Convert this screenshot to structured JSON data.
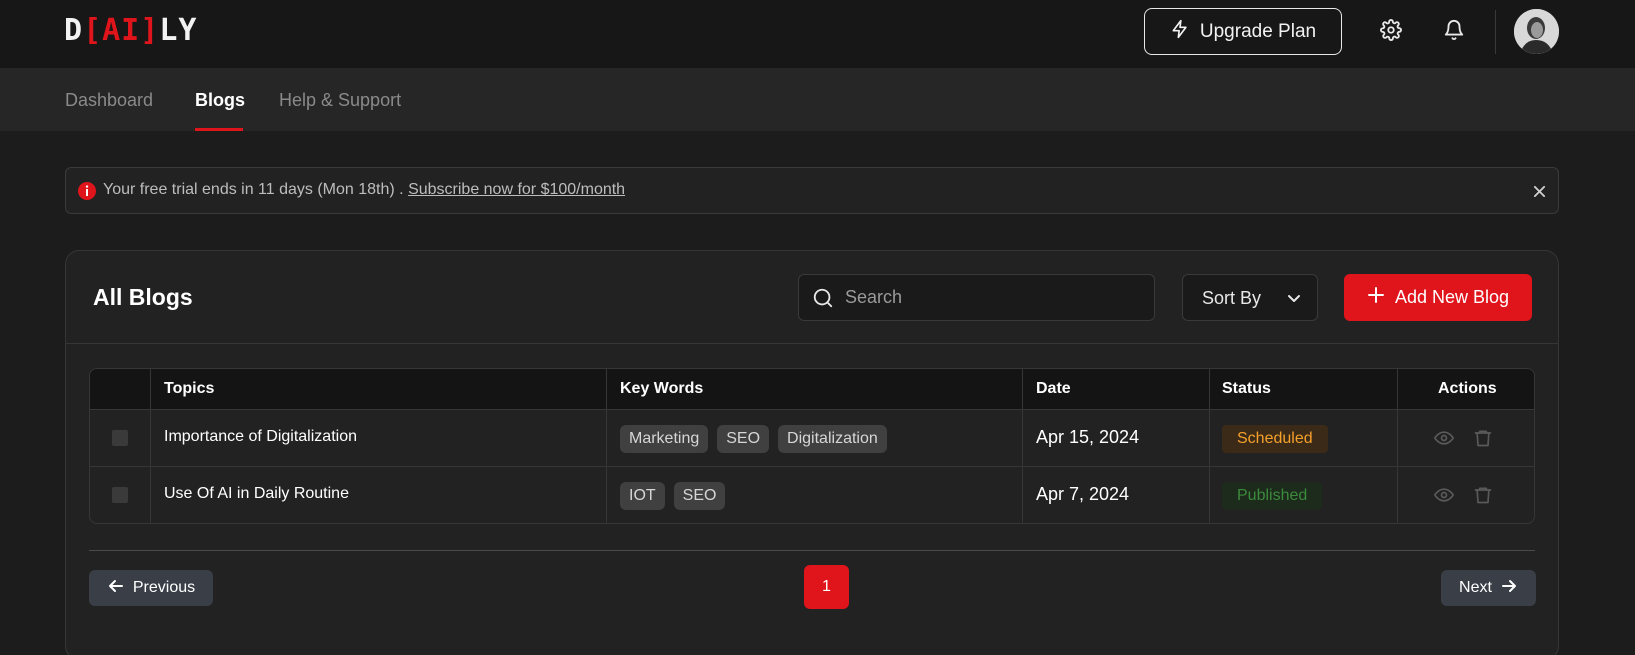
{
  "header": {
    "logo": {
      "prefix": "D",
      "bracket_open": "[",
      "ai": "AI",
      "bracket_close": "]",
      "suffix": "LY"
    },
    "upgrade_label": "Upgrade Plan",
    "icons": [
      "lightning-icon",
      "gear-icon",
      "bell-icon"
    ]
  },
  "nav": {
    "tabs": [
      {
        "label": "Dashboard",
        "active": false
      },
      {
        "label": "Blogs",
        "active": true
      },
      {
        "label": "Help & Support",
        "active": false
      }
    ]
  },
  "alert": {
    "text": "Your free trial ends in 11 days (Mon 18th) .",
    "link": "Subscribe now for $100/month"
  },
  "blogs": {
    "title": "All Blogs",
    "search_placeholder": "Search",
    "sort_label": "Sort By",
    "add_label": "Add New Blog",
    "columns": [
      "Topics",
      "Key Words",
      "Date",
      "Status",
      "Actions"
    ],
    "rows": [
      {
        "topic": "Importance of Digitalization",
        "keywords": [
          "Marketing",
          "SEO",
          "Digitalization"
        ],
        "date": "Apr 15, 2024",
        "status": "Scheduled"
      },
      {
        "topic": "Use Of AI in Daily Routine",
        "keywords": [
          "IOT",
          "SEO"
        ],
        "date": "Apr 7, 2024",
        "status": "Published"
      }
    ]
  },
  "pagination": {
    "previous_label": "Previous",
    "current_page": "1",
    "next_label": "Next"
  },
  "colors": {
    "accent": "#e0141b",
    "scheduled": "#f5a02a",
    "published": "#3c8a3c"
  }
}
